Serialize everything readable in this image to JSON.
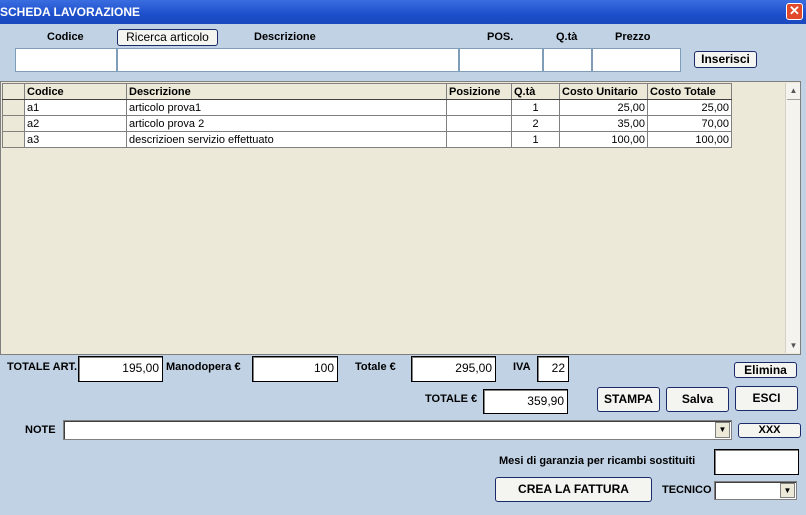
{
  "window": {
    "title": "SCHEDA LAVORAZIONE",
    "close_glyph": "✕"
  },
  "entry": {
    "codice_label": "Codice",
    "ricerca_button": "Ricerca articolo",
    "descrizione_label": "Descrizione",
    "pos_label": "POS.",
    "qta_label": "Q.tà",
    "prezzo_label": "Prezzo",
    "inserisci_button": "Inserisci",
    "codice_value": "",
    "descrizione_value": "",
    "pos_value": "",
    "qta_value": "",
    "prezzo_value": ""
  },
  "grid": {
    "columns": [
      "Codice",
      "Descrizione",
      "Posizione",
      "Q.tà",
      "Costo Unitario",
      "Costo Totale"
    ],
    "rows": [
      {
        "codice": "a1",
        "descrizione": "articolo prova1",
        "posizione": "",
        "qta": "1",
        "costo_unitario": "25,00",
        "costo_totale": "25,00"
      },
      {
        "codice": "a2",
        "descrizione": "articolo prova 2",
        "posizione": "",
        "qta": "2",
        "costo_unitario": "35,00",
        "costo_totale": "70,00"
      },
      {
        "codice": "a3",
        "descrizione": "descrizioen servizio effettuato",
        "posizione": "",
        "qta": "1",
        "costo_unitario": "100,00",
        "costo_totale": "100,00"
      }
    ]
  },
  "totals": {
    "totale_art_label": "TOTALE ART.",
    "totale_art_value": "195,00",
    "manodopera_label": "Manodopera €",
    "manodopera_value": "100",
    "totale_label": "Totale €",
    "totale_value": "295,00",
    "iva_label": "IVA",
    "iva_value": "22",
    "totale_iva_label": "TOTALE €",
    "totale_iva_value": "359,90"
  },
  "actions": {
    "elimina": "Elimina",
    "stampa": "STAMPA",
    "salva": "Salva",
    "esci": "ESCI",
    "xxx": "XXX",
    "crea_fattura": "CREA LA FATTURA"
  },
  "note": {
    "label": "NOTE",
    "value": ""
  },
  "garanzia": {
    "label": "Mesi di garanzia per ricambi sostituiti",
    "value": ""
  },
  "tecnico": {
    "label": "TECNICO",
    "value": ""
  },
  "colors": {
    "background": "#c0d2e4",
    "titlebar": "#2a5ad4",
    "grid_background": "#ece9d8"
  }
}
